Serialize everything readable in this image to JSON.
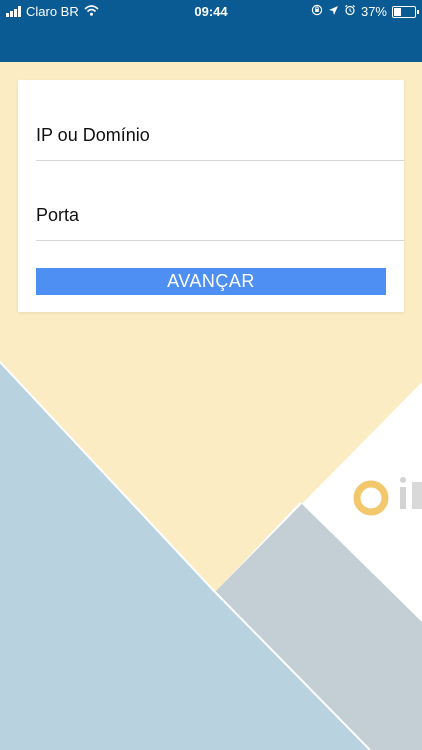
{
  "status_bar": {
    "carrier": "Claro BR",
    "time": "09:44",
    "battery_percent": "37%",
    "battery_level": 0.37,
    "icons": [
      "signal-icon",
      "wifi-icon",
      "orientation-lock-icon",
      "location-icon",
      "alarm-icon",
      "battery-icon"
    ]
  },
  "form": {
    "ip_placeholder": "IP ou Domínio",
    "port_placeholder": "Porta",
    "submit_label": "AVANÇAR"
  },
  "colors": {
    "header": "#0a5a94",
    "button": "#4d8ff2",
    "background_yellow": "#fcecc4",
    "background_blue": "#b8d3df",
    "background_gray": "#c3cfd5"
  }
}
